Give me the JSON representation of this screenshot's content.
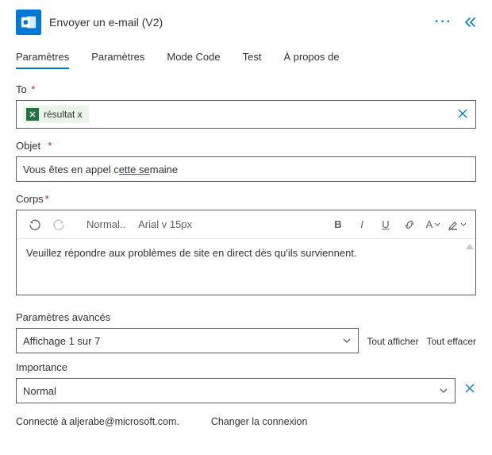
{
  "header": {
    "title": "Envoyer un e-mail (V2)"
  },
  "tabs": {
    "t0": "Paramètres",
    "t1": "Paramètres",
    "t2": "Mode Code",
    "t3": "Test",
    "t4": "À propos de"
  },
  "fields": {
    "to_label": "To",
    "to_token": "résultat x",
    "subject_label": "Objet",
    "subject_value_a": "Vous êtes en appel c",
    "subject_value_b": "ette se",
    "subject_value_c": "maine",
    "body_label": "Corps",
    "body_format_style": "Normal..",
    "body_format_font": "Arial v 15px",
    "body_text": "Veuillez répondre aux problèmes de site en direct dès qu'ils surviennent.",
    "advanced_label": "Paramètres avancés",
    "advanced_value": "Affichage 1 sur 7",
    "show_all": "Tout afficher",
    "clear_all": "Tout effacer",
    "importance_label": "Importance",
    "importance_value": "Normal"
  },
  "footer": {
    "connected": "Connecté à aljerabe@microsoft.com.",
    "change": "Changer la connexion"
  }
}
